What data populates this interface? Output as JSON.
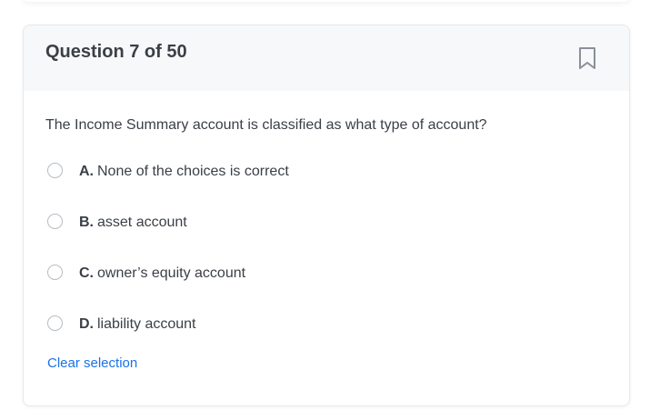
{
  "question": {
    "number_label": "Question 7 of 50",
    "text": "The Income Summary account is classified as what type of account?",
    "bookmark_icon": "bookmark-icon"
  },
  "options": [
    {
      "letter": "A.",
      "text": "None of the choices is correct",
      "selected": false
    },
    {
      "letter": "B.",
      "text": "asset account",
      "selected": false
    },
    {
      "letter": "C.",
      "text": "owner’s equity account",
      "selected": false
    },
    {
      "letter": "D.",
      "text": "liability account",
      "selected": false
    }
  ],
  "actions": {
    "clear_label": "Clear selection"
  },
  "colors": {
    "accent": "#1a73e8",
    "text": "#3b4047",
    "header_bg": "#f7f8fa"
  }
}
